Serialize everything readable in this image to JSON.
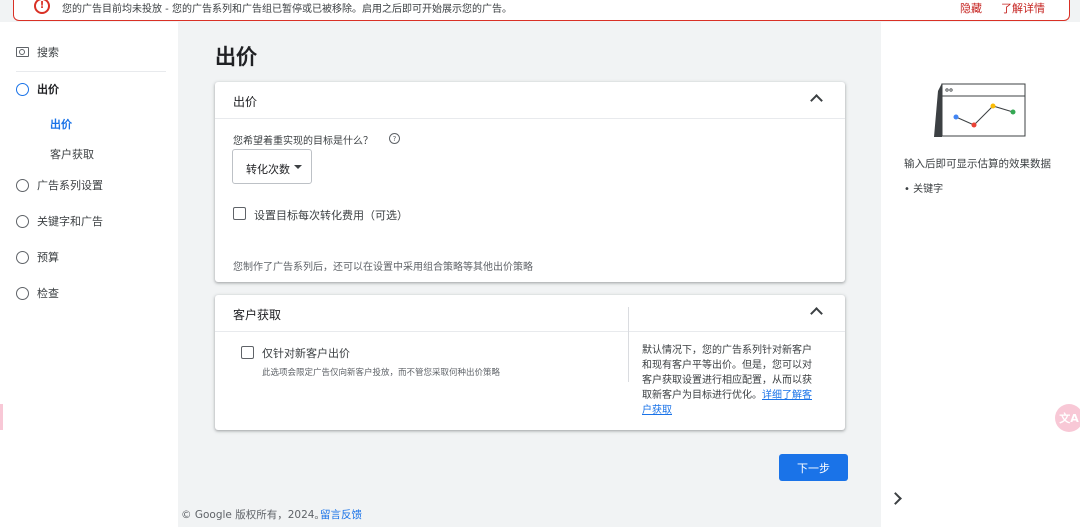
{
  "alert": {
    "icon": "!",
    "text": "您的广告目前均未投放 - 您的广告系列和广告组已暂停或已被移除。启用之后即可开始展示您的广告。",
    "hide_label": "隐藏",
    "more_label": "了解详情"
  },
  "sidebar": {
    "search": "搜索",
    "items": [
      {
        "label": "出价"
      },
      {
        "label": "广告系列设置"
      },
      {
        "label": "关键字和广告"
      },
      {
        "label": "预算"
      },
      {
        "label": "检查"
      }
    ],
    "sub_items": [
      {
        "label": "出价"
      },
      {
        "label": "客户获取"
      }
    ]
  },
  "main": {
    "title": "出价",
    "bidding_card": {
      "title": "出价",
      "question": "您希望着重实现的目标是什么？",
      "help": "?",
      "select_value": "转化次数",
      "checkbox_label": "设置目标每次转化费用（可选）",
      "note": "您制作了广告系列后，还可以在设置中采用组合策略等其他出价策略"
    },
    "acquisition_card": {
      "title": "客户获取",
      "checkbox_label": "仅针对新客户出价",
      "small_note": "此选项会限定广告仅向新客户投放，而不管您采取何种出价策略",
      "side_text": "默认情况下，您的广告系列针对新客户和现有客户平等出价。但是，您可以对客户获取设置进行相应配置，从而以获取新客户为目标进行优化。",
      "side_link": "详细了解客户获取"
    },
    "next_label": "下一步"
  },
  "footer": {
    "copyright": "© Google 版权所有，2024。",
    "feedback": "留言反馈"
  },
  "right_panel": {
    "description": "输入后即可显示估算的效果数据",
    "bullet": "• 关键字"
  },
  "float_button": "文A",
  "colors": {
    "accent": "#1a73e8",
    "alert": "#d93025"
  }
}
